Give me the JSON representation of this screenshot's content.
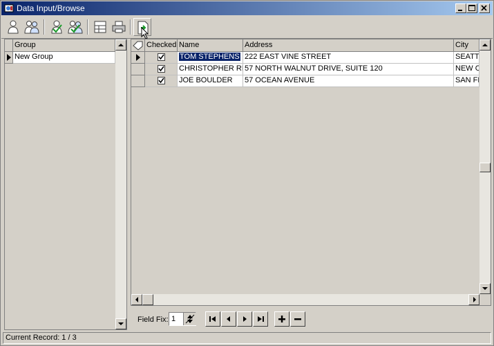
{
  "window": {
    "title": "Data Input/Browse",
    "controls": [
      "minimize",
      "maximize",
      "close"
    ]
  },
  "toolbar": {
    "buttons": [
      {
        "name": "single-user-icon"
      },
      {
        "name": "multi-user-icon"
      },
      {
        "name": "check-single-user-icon"
      },
      {
        "name": "check-multi-user-icon"
      },
      {
        "name": "layout-icon"
      },
      {
        "name": "print-icon"
      },
      {
        "name": "document-arrow-icon",
        "active": true
      }
    ]
  },
  "groups": {
    "header": "Group",
    "rows": [
      "New Group"
    ]
  },
  "records": {
    "columns": [
      "Checked",
      "Name",
      "Address",
      "City"
    ],
    "rows": [
      {
        "checked": true,
        "name": "TOM STEPHENS",
        "address": "222 EAST VINE STREET",
        "city": "SEATTLE"
      },
      {
        "checked": true,
        "name": "CHRISTOPHER REED",
        "address": "57 NORTH WALNUT DRIVE, SUITE 120",
        "city": "NEW ORLEANS"
      },
      {
        "checked": true,
        "name": "JOE BOULDER",
        "address": "57 OCEAN AVENUE",
        "city": "SAN FRANCISCO"
      }
    ],
    "current_row": 0
  },
  "field_fix": {
    "label": "Field Fix:",
    "value": "1"
  },
  "status": {
    "text": "Current Record: 1 / 3"
  },
  "colors": {
    "title_start": "#0a246a",
    "title_end": "#a6caf0",
    "face": "#d4d0c8",
    "selection": "#0a246a"
  }
}
